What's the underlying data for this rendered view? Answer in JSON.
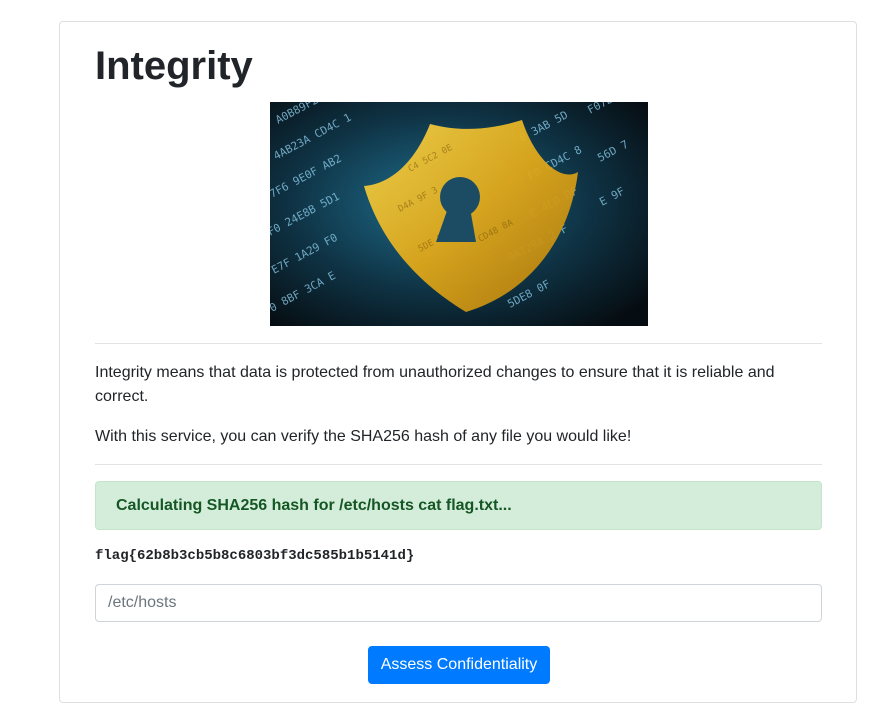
{
  "page": {
    "title": "Integrity",
    "intro": "Integrity means that data is protected from unauthorized changes to ensure that it is reliable and correct.",
    "service_text": "With this service, you can verify the SHA256 hash of any file you would like!"
  },
  "hero": {
    "image_name": "lock-shield-hex-data-image",
    "colors": {
      "background": "#0d1b24",
      "shield": "#e8b51a",
      "digits": "#7fc7e8"
    }
  },
  "result": {
    "alert_text": "Calculating SHA256 hash for /etc/hosts cat flag.txt...",
    "output": "flag{62b8b3cb5b8c6803bf3dc585b1b5141d}"
  },
  "form": {
    "input_placeholder": "/etc/hosts",
    "submit_label": "Assess Confidentiality"
  },
  "colors": {
    "primary": "#007bff",
    "success_bg": "#d4edda",
    "success_text": "#155724"
  }
}
